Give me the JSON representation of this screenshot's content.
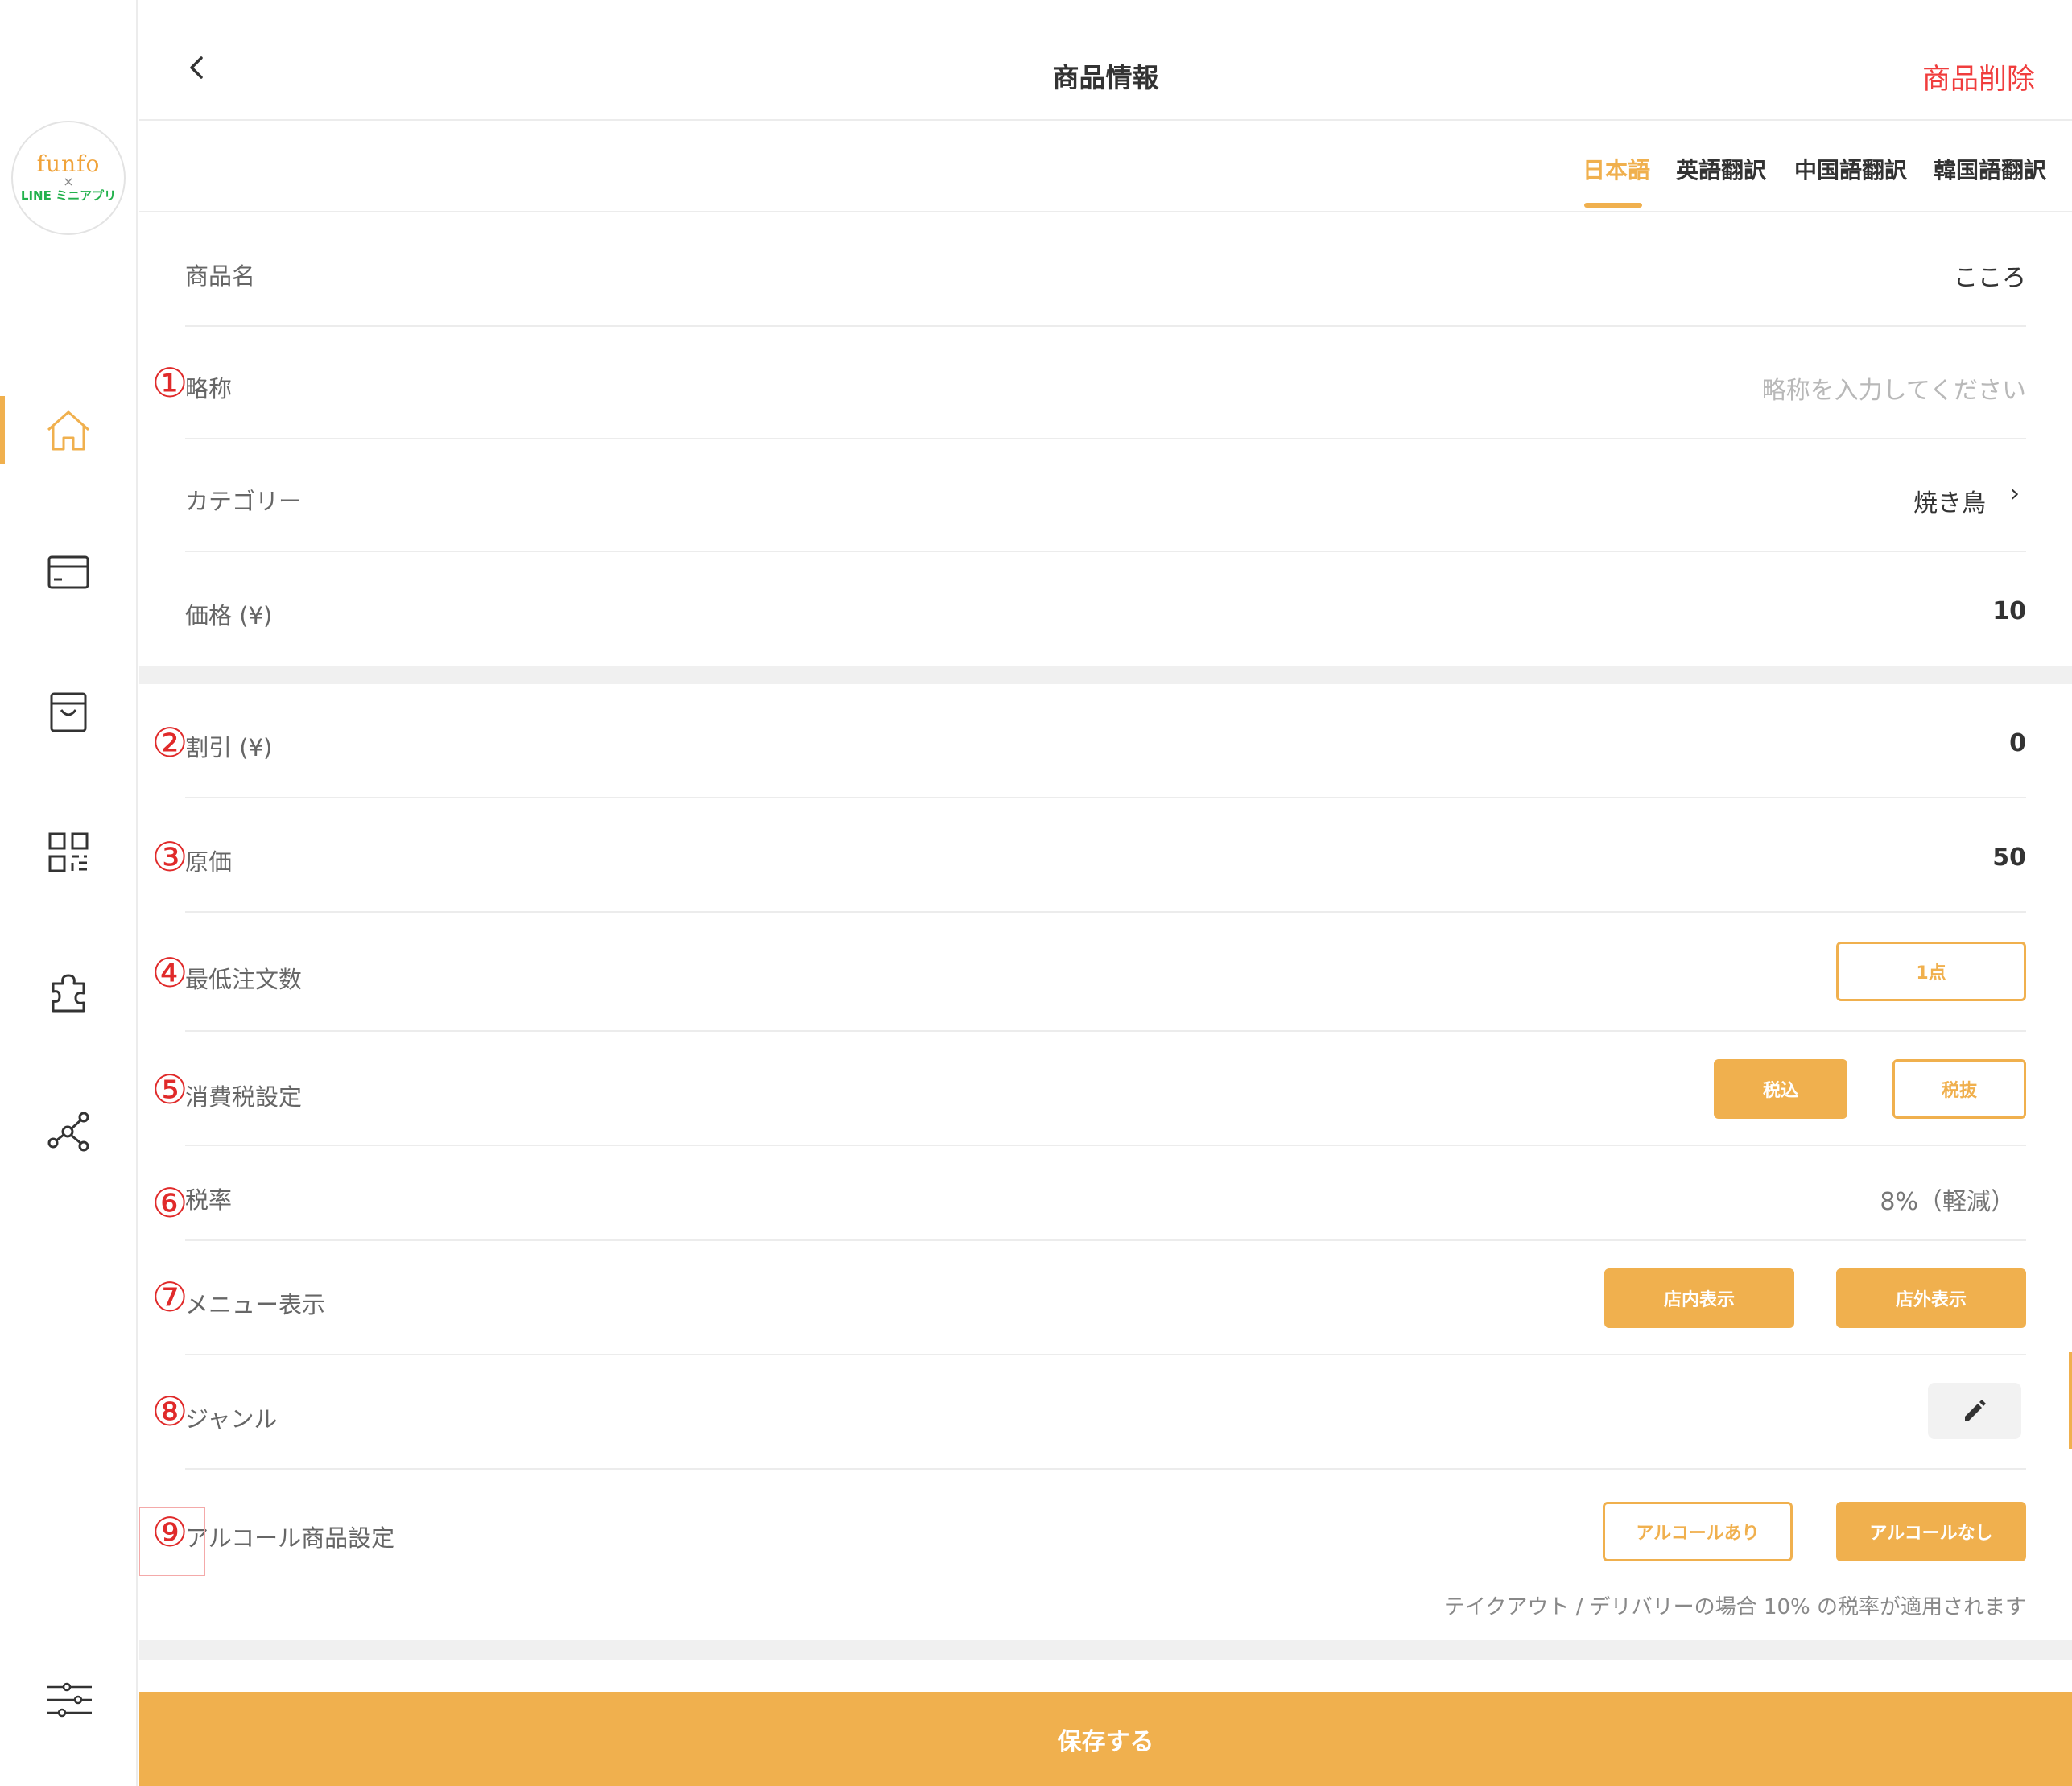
{
  "sidebar": {
    "logo": {
      "line1": "funfo",
      "line2": "×",
      "line3": "LINE ミニアプリ"
    },
    "nav": [
      {
        "icon": "home-icon",
        "active": true
      },
      {
        "icon": "card-icon",
        "active": false
      },
      {
        "icon": "shopping-bag-icon",
        "active": false
      },
      {
        "icon": "qr-code-icon",
        "active": false
      },
      {
        "icon": "puzzle-icon",
        "active": false
      },
      {
        "icon": "network-icon",
        "active": false
      }
    ],
    "bottom_icon": "settings-sliders-icon"
  },
  "header": {
    "title": "商品情報",
    "delete_label": "商品削除"
  },
  "languages": {
    "tabs": [
      "日本語",
      "英語翻訳",
      "中国語翻訳",
      "韓国語翻訳"
    ],
    "active": 0
  },
  "fields": {
    "name": {
      "label": "商品名",
      "value": "こころ"
    },
    "short_name": {
      "label": "略称",
      "placeholder": "略称を入力してください"
    },
    "category": {
      "label": "カテゴリー",
      "value": "焼き鳥",
      "chevron": "›"
    },
    "price": {
      "label": "価格 (¥)",
      "value": "10"
    },
    "discount": {
      "label": "割引 (¥)",
      "value": "0"
    },
    "cost": {
      "label": "原価",
      "value": "50"
    },
    "min_order": {
      "label": "最低注文数",
      "button": "1点"
    },
    "tax_setting": {
      "label": "消費税設定",
      "options": [
        "税込",
        "税抜"
      ],
      "selected": "税込"
    },
    "tax_rate": {
      "label": "税率",
      "value": "8%（軽減）"
    },
    "menu_display": {
      "label": "メニュー表示",
      "options": [
        "店内表示",
        "店外表示"
      ]
    },
    "genre": {
      "label": "ジャンル"
    },
    "alcohol": {
      "label": "アルコール商品設定",
      "options": [
        "アルコールあり",
        "アルコールなし"
      ],
      "selected": "アルコールなし"
    }
  },
  "markers": [
    "①",
    "②",
    "③",
    "④",
    "⑤",
    "⑥",
    "⑦",
    "⑧",
    "⑨"
  ],
  "note": "テイクアウト / デリバリーの場合 10% の税率が適用されます",
  "save_label": "保存する",
  "colors": {
    "accent": "#f0b04e",
    "danger": "#f03d3d",
    "marker": "#e02a2a"
  }
}
